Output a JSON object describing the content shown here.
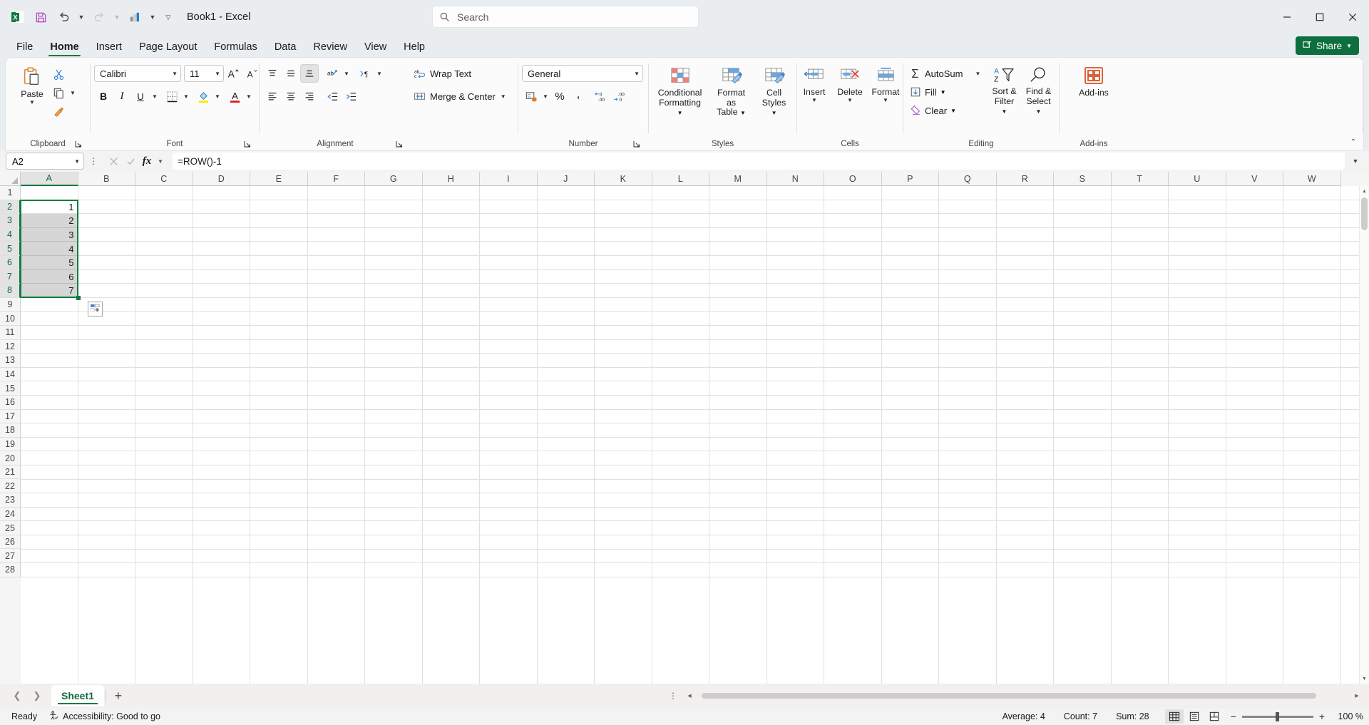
{
  "titlebar": {
    "app_icon": "excel-icon",
    "quick_access": [
      {
        "name": "save-icon",
        "label": "Save"
      },
      {
        "name": "undo-icon",
        "label": "Undo"
      },
      {
        "name": "redo-icon",
        "label": "Redo"
      },
      {
        "name": "chart-icon",
        "label": "Charts"
      },
      {
        "name": "customize-quick-access-icon",
        "label": "Customize Quick Access Toolbar"
      }
    ],
    "title": "Book1  -  Excel",
    "search_placeholder": "Search",
    "window_controls": [
      "minimize",
      "maximize",
      "close"
    ]
  },
  "ribbon": {
    "tabs": [
      {
        "label": "File",
        "active": false
      },
      {
        "label": "Home",
        "active": true
      },
      {
        "label": "Insert",
        "active": false
      },
      {
        "label": "Page Layout",
        "active": false
      },
      {
        "label": "Formulas",
        "active": false
      },
      {
        "label": "Data",
        "active": false
      },
      {
        "label": "Review",
        "active": false
      },
      {
        "label": "View",
        "active": false
      },
      {
        "label": "Help",
        "active": false
      }
    ],
    "share_label": "Share",
    "collapse_label": "Collapse Ribbon",
    "groups": {
      "clipboard": {
        "label": "Clipboard",
        "paste_label": "Paste",
        "cut_label": "Cut",
        "copy_label": "Copy",
        "format_painter_label": "Format Painter"
      },
      "font": {
        "label": "Font",
        "font_name": "Calibri",
        "font_size": "11",
        "grow_label": "Increase Font Size",
        "shrink_label": "Decrease Font Size",
        "bold_label": "B",
        "italic_label": "I",
        "underline_label": "U",
        "borders_label": "Borders",
        "fill_color_label": "Fill Color",
        "font_color_label": "Font Color"
      },
      "alignment": {
        "label": "Alignment",
        "wrap_text_label": "Wrap Text",
        "merge_center_label": "Merge & Center",
        "orientation_label": "Orientation",
        "indent_label": "Indent"
      },
      "number": {
        "label": "Number",
        "format_value": "General",
        "accounting_label": "Accounting Number Format",
        "percent_label": "%",
        "comma_label": "Comma Style",
        "increase_decimal_label": "Increase Decimal",
        "decrease_decimal_label": "Decrease Decimal"
      },
      "styles": {
        "label": "Styles",
        "conditional_formatting_label": "Conditional\nFormatting",
        "conditional_formatting_l1": "Conditional",
        "conditional_formatting_l2": "Formatting",
        "format_as_table_l1": "Format as",
        "format_as_table_l2": "Table",
        "cell_styles_l1": "Cell",
        "cell_styles_l2": "Styles"
      },
      "cells": {
        "label": "Cells",
        "insert_label": "Insert",
        "delete_label": "Delete",
        "format_label": "Format"
      },
      "editing": {
        "label": "Editing",
        "autosum_label": "AutoSum",
        "fill_label": "Fill",
        "clear_label": "Clear",
        "sort_filter_l1": "Sort &",
        "sort_filter_l2": "Filter",
        "find_select_l1": "Find &",
        "find_select_l2": "Select"
      },
      "addins": {
        "label": "Add-ins",
        "addins_label": "Add-ins"
      }
    }
  },
  "formula_bar": {
    "name_box_value": "A2",
    "cancel_label": "Cancel",
    "enter_label": "Enter",
    "fx_label": "fx",
    "formula_value": "=ROW()-1",
    "expand_label": "Expand Formula Bar"
  },
  "grid": {
    "columns": [
      "A",
      "B",
      "C",
      "D",
      "E",
      "F",
      "G",
      "H",
      "I",
      "J",
      "K",
      "L",
      "M",
      "N",
      "O",
      "P",
      "Q",
      "R",
      "S",
      "T",
      "U",
      "V",
      "W"
    ],
    "selected_column": "A",
    "rows": [
      1,
      2,
      3,
      4,
      5,
      6,
      7,
      8,
      9,
      10,
      11,
      12,
      13,
      14,
      15,
      16,
      17,
      18,
      19,
      20,
      21,
      22,
      23,
      24,
      25,
      26,
      27,
      28
    ],
    "selected_rows": [
      2,
      3,
      4,
      5,
      6,
      7,
      8
    ],
    "active_cell": "A2",
    "selection_range": "A2:A8",
    "cells": [
      {
        "ref": "A2",
        "row": 2,
        "col": 0,
        "value": "1"
      },
      {
        "ref": "A3",
        "row": 3,
        "col": 0,
        "value": "2"
      },
      {
        "ref": "A4",
        "row": 4,
        "col": 0,
        "value": "3"
      },
      {
        "ref": "A5",
        "row": 5,
        "col": 0,
        "value": "4"
      },
      {
        "ref": "A6",
        "row": 6,
        "col": 0,
        "value": "5"
      },
      {
        "ref": "A7",
        "row": 7,
        "col": 0,
        "value": "6"
      },
      {
        "ref": "A8",
        "row": 8,
        "col": 0,
        "value": "7"
      }
    ],
    "autofill_options_label": "Auto Fill Options"
  },
  "sheet_bar": {
    "prev_label": "Previous Sheet",
    "next_label": "Next Sheet",
    "tabs": [
      {
        "label": "Sheet1",
        "active": true
      }
    ],
    "add_sheet_label": "New sheet",
    "all_sheets_label": "All Sheets"
  },
  "status_bar": {
    "mode": "Ready",
    "accessibility": "Accessibility: Good to go",
    "average": "Average: 4",
    "count": "Count: 7",
    "sum": "Sum: 28",
    "views": [
      {
        "name": "normal-view",
        "label": "Normal",
        "active": true
      },
      {
        "name": "page-layout-view",
        "label": "Page Layout",
        "active": false
      },
      {
        "name": "page-break-preview",
        "label": "Page Break Preview",
        "active": false
      }
    ],
    "zoom_out_label": "Zoom Out",
    "zoom_in_label": "Zoom In",
    "zoom_value": "100 %"
  },
  "colors": {
    "excel_green": "#107c41",
    "share_green": "#0e6f3e",
    "titlebar_bg": "#e9edf0",
    "ribbon_bg": "#fbfbfb",
    "accent_orange": "#d8522a"
  }
}
